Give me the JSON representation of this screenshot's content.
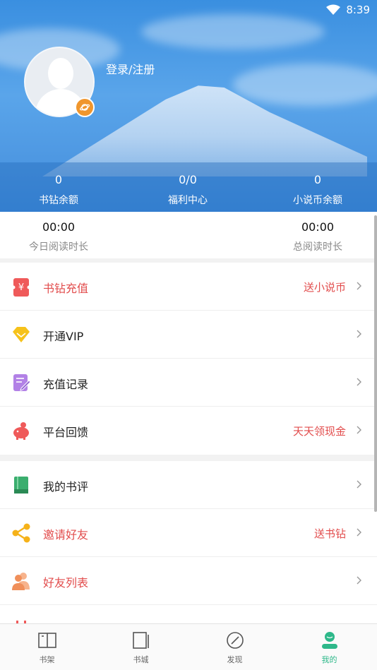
{
  "status_bar": {
    "time": "8:39"
  },
  "profile": {
    "login_label": "登录/注册"
  },
  "stats": [
    {
      "value": "0",
      "label": "书钻余额"
    },
    {
      "value": "0/0",
      "label": "福利中心"
    },
    {
      "value": "0",
      "label": "小说币余额"
    }
  ],
  "reading": {
    "today": {
      "value": "00:00",
      "label": "今日阅读时长"
    },
    "total": {
      "value": "00:00",
      "label": "总阅读时长"
    }
  },
  "menu_group_1": [
    {
      "label": "书钻充值",
      "right": "送小说币",
      "icon": "yuan-icon",
      "red": true
    },
    {
      "label": "开通VIP",
      "right": "",
      "icon": "diamond-icon",
      "red": false
    },
    {
      "label": "充值记录",
      "right": "",
      "icon": "note-icon",
      "red": false
    },
    {
      "label": "平台回馈",
      "right": "天天领现金",
      "icon": "piggy-bank-icon",
      "red": false
    }
  ],
  "menu_group_2": [
    {
      "label": "我的书评",
      "right": "",
      "icon": "book-icon",
      "red": false
    },
    {
      "label": "邀请好友",
      "right": "送书钻",
      "icon": "share-icon",
      "red": true
    },
    {
      "label": "好友列表",
      "right": "",
      "icon": "friends-icon",
      "red": true
    }
  ],
  "bottom_nav": [
    {
      "label": "书架",
      "icon": "bookshelf-icon"
    },
    {
      "label": "书城",
      "icon": "bookstore-icon"
    },
    {
      "label": "发现",
      "icon": "compass-icon"
    },
    {
      "label": "我的",
      "icon": "profile-icon",
      "active": true
    }
  ],
  "colors": {
    "accent_red": "#e24c4c",
    "active_green": "#2eb88a",
    "badge_orange": "#f0962d"
  }
}
